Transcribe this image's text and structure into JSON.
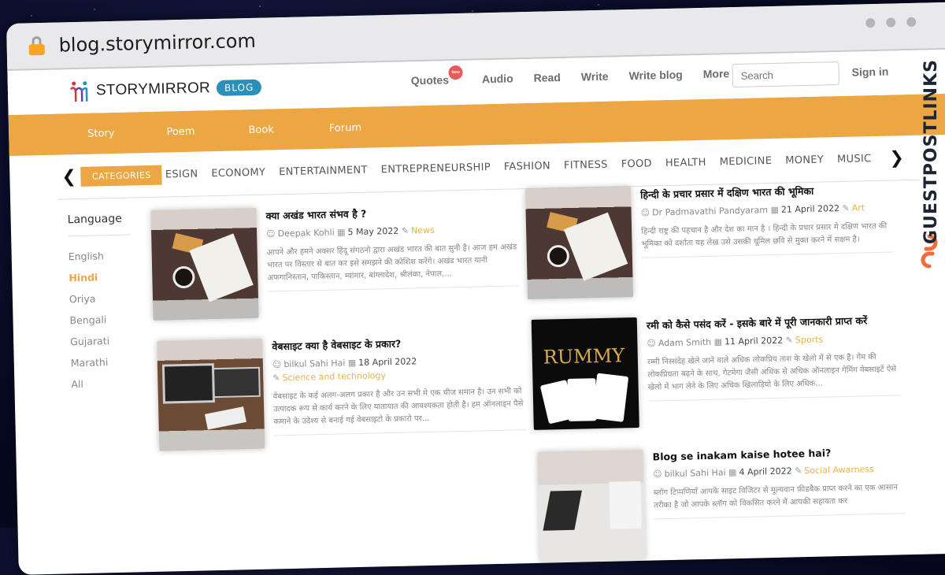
{
  "browser": {
    "url": "blog.storymirror.com",
    "lock_icon": "lock-icon"
  },
  "brand": {
    "logo_text": "STORYMIRROR",
    "badge": "BLOG",
    "accent": "#eca744",
    "badge_color": "#2b8fb8"
  },
  "topnav": {
    "links": [
      "Quotes",
      "Audio",
      "Read",
      "Write",
      "Write blog",
      "More"
    ],
    "new_badge": "New",
    "search_placeholder": "Search",
    "signin": "Sign in"
  },
  "subnav": {
    "items": [
      "Story",
      "Poem",
      "Book",
      "Forum"
    ]
  },
  "categories": {
    "label": "CATEGORIES",
    "items": [
      "ESIGN",
      "ECONOMY",
      "ENTERTAINMENT",
      "ENTREPRENEURSHIP",
      "FASHION",
      "FITNESS",
      "FOOD",
      "HEALTH",
      "MEDICINE",
      "MONEY",
      "MUSIC"
    ]
  },
  "language": {
    "title": "Language",
    "items": [
      "English",
      "Hindi",
      "Oriya",
      "Bengali",
      "Gujarati",
      "Marathi",
      "All"
    ],
    "active": "Hindi"
  },
  "posts": [
    {
      "title": "क्या अखंड भारत संभव है ?",
      "author": "Deepak Kohli",
      "date": "5 May 2022",
      "category": "News",
      "excerpt": "आपने और हमने अक्सर हिंदू संगठनो द्वारा अखंड भारत की बात सुनी है। आज हम अखंड भारत पर विस्तार से बात कर इसे समझने की कोशिश करेंगे। अखंड भारत यानी अफगानिस्तान, पाकिस्तान, म्यांमार, बांग्लादेश, श्रीलंका, नेपाल,..."
    },
    {
      "title": "हिन्दी के प्रचार प्रसार में दक्षिण भारत की भूमिका",
      "author": "Dr Padmavathi Pandyaram",
      "date": "21 April 2022",
      "category": "Art",
      "excerpt": "हिन्दी राष्ट्र की पहचान है और देश का मान है । हिन्दी के प्रचार प्रसार मे दक्षिण भारत की भूमिका को दर्शाता यह लेख उसे उसकी धूमिल छवि से मुक्त करने में सक्षम है।"
    },
    {
      "title": "वेबसाइट क्या है वेबसाइट के प्रकार?",
      "author": "bilkul Sahi Hai",
      "date": "18 April 2022",
      "category": "Science and technology",
      "excerpt": "वेबसाइट के कई अलग-अलग प्रकार है और उन सभी मे एक चीज समान है। उन सभी को उत्पादक रूप से कार्य करने के लिए यातायात की आवश्यकता होती है। हम ऑनलाइन पैसे कमाने के उदेश्य से बनाई गई वेबसाइटो के प्रकारो पर..."
    },
    {
      "title": "रमी को कैसे पसंद करें - इसके बारे में पूरी जानकारी प्राप्त करें",
      "author": "Adam Smith",
      "date": "11 April 2022",
      "category": "Sports",
      "excerpt": "रम्मी निस्संदेह खेले जाने वाले अधिक लोकप्रिय ताश के खेलो में से एक है। गेम की लोकप्रियता बढ़ने के साथ, गेटमेगा जैसी अधिक से अधिक ऑनलाइन गेमिंग वेबसाइटें ऐसे खेलो में भाग लेने के लिए अधिक खिलाड़ियो के लिए अधिक...",
      "thumb_text": "RUMMY"
    },
    {
      "title": "Blog se inakam kaise hotee hai?",
      "author": "bilkul Sahi Hai",
      "date": "4 April 2022",
      "category": "Social Awarness",
      "excerpt": "ब्लॉग टिप्पणियाँ आपके साइट विजिटर से मूल्यवान फ़ीडबैक प्राप्त करने का एक आसान तरीका है जो आपके ब्लॉग को विकसित करने में आपकी सहायता कर"
    }
  ],
  "watermark": {
    "text": "GUESTPOSTLINKS",
    "accent": "#f26b3a"
  }
}
